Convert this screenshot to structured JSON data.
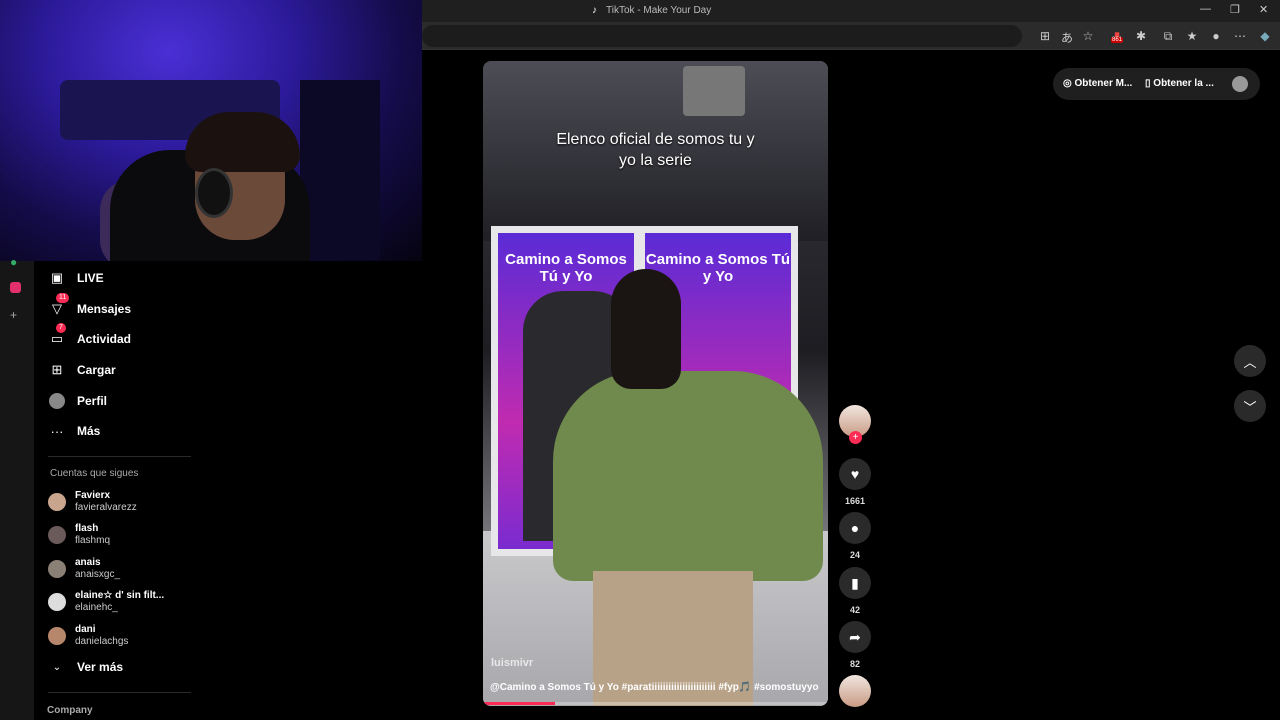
{
  "browser": {
    "tab_title": "TikTok - Make Your Day",
    "extension_badge": "861"
  },
  "top_right": {
    "get_coins": "Obtener M...",
    "get_app": "Obtener la ..."
  },
  "sidebar": {
    "nav": [
      {
        "label": "LIVE",
        "icon": "live-icon"
      },
      {
        "label": "Mensajes",
        "icon": "messages-icon",
        "badge": "11"
      },
      {
        "label": "Actividad",
        "icon": "activity-icon",
        "badge": "7"
      },
      {
        "label": "Cargar",
        "icon": "upload-icon"
      },
      {
        "label": "Perfil",
        "icon": "profile-avatar"
      },
      {
        "label": "Más",
        "icon": "more-icon"
      }
    ],
    "following_title": "Cuentas que sigues",
    "following": [
      {
        "name": "Favierx",
        "handle": "favieralvarezz"
      },
      {
        "name": "flash",
        "handle": "flashmq"
      },
      {
        "name": "anais",
        "handle": "anaisxgc_"
      },
      {
        "name": "elaine☆ d' sin filt...",
        "handle": "elainehc_"
      },
      {
        "name": "dani",
        "handle": "danielachgs"
      }
    ],
    "see_more": "Ver más",
    "company": "Company"
  },
  "video": {
    "caption_line1": "Elenco oficial de somos tu y",
    "caption_line2": "yo la serie",
    "panel_text_left": "Camino a Somos Tú y Yo",
    "panel_text_right": "Camino a Somos Tú y Yo",
    "author": "luismivr",
    "description": "@Camino a Somos Tú y Yo #paratiiiiiiiiiiiiiiiiiiiiiii #fyp🎵 #somostuyyo",
    "progress": 0.21
  },
  "actions": {
    "likes": "1661",
    "comments": "24",
    "saves": "42",
    "shares": "82"
  },
  "colors": {
    "accent": "#fe2c55",
    "background": "#000000"
  }
}
